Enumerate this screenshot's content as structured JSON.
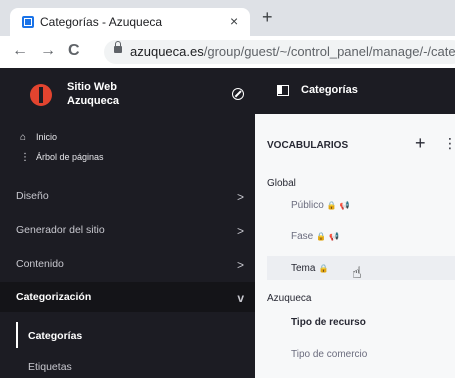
{
  "browser": {
    "tab_title": "Categorías - Azuqueca",
    "tab_close": "×",
    "new_tab": "+",
    "back": "←",
    "forward": "→",
    "reload": "C",
    "url_domain": "azuqueca.es",
    "url_path": "/group/guest/~/control_panel/manage/-/categori"
  },
  "sidebar": {
    "site_name": "Sitio Web Azuqueca",
    "links": [
      {
        "icon": "⌂",
        "label": "Inicio"
      },
      {
        "icon": "⋮",
        "label": "Árbol de páginas"
      }
    ],
    "sections": [
      {
        "label": "Diseño",
        "chevron": ">"
      },
      {
        "label": "Generador del sitio",
        "chevron": ">"
      },
      {
        "label": "Contenido",
        "chevron": ">"
      },
      {
        "label": "Categorización",
        "chevron": "v"
      }
    ],
    "subitems": [
      {
        "label": "Categorías"
      },
      {
        "label": "Etiquetas"
      }
    ]
  },
  "main": {
    "title": "Categorías",
    "vocabularies_label": "VOCABULARIOS",
    "plus": "+",
    "kebab": "⋮",
    "groups": [
      {
        "label": "Global"
      },
      {
        "label": "Azuqueca"
      }
    ],
    "items": [
      {
        "label": "Público",
        "lock": "🔒",
        "megaphone": "📢"
      },
      {
        "label": "Fase",
        "lock": "🔒",
        "megaphone": "📢"
      },
      {
        "label": "Tema",
        "lock": "🔒"
      },
      {
        "label": "Tipo de recurso"
      },
      {
        "label": "Tipo de comercio"
      }
    ]
  },
  "cursor": "☝"
}
